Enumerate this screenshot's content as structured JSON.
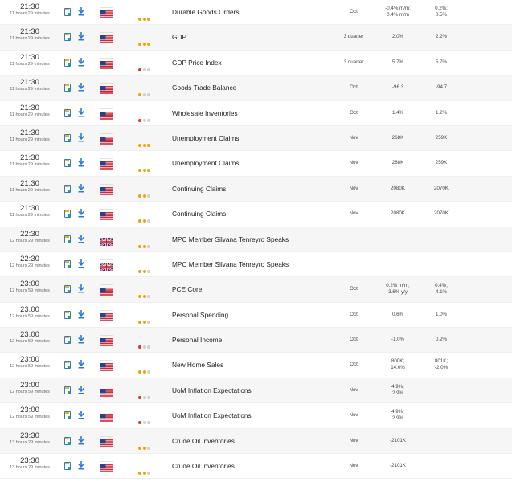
{
  "rows": [
    {
      "time": "21:30",
      "remaining": "11 hours 29 minutes",
      "country": "US",
      "importance": [
        "orange",
        "orange",
        "orange"
      ],
      "name": "Durable Goods Orders",
      "period": "Oct",
      "actual": "-0.4% m/m;\n0.4% m/m",
      "previous": "0.2%;\n0.5%"
    },
    {
      "time": "21:30",
      "remaining": "11 hours 29 minutes",
      "country": "US",
      "importance": [
        "orange",
        "orange",
        "orange"
      ],
      "name": "GDP",
      "period": "3 quarter",
      "actual": "2.0%",
      "previous": "2.2%"
    },
    {
      "time": "21:30",
      "remaining": "11 hours 29 minutes",
      "country": "US",
      "importance": [
        "red",
        "grey",
        "grey"
      ],
      "name": "GDP Price Index",
      "period": "3 quarter",
      "actual": "5.7%",
      "previous": "5.7%"
    },
    {
      "time": "21:30",
      "remaining": "11 hours 29 minutes",
      "country": "US",
      "importance": [
        "orange",
        "grey",
        "grey"
      ],
      "name": "Goods Trade Balance",
      "period": "Oct",
      "actual": "-96.3",
      "previous": "-94.7"
    },
    {
      "time": "21:30",
      "remaining": "11 hours 29 minutes",
      "country": "US",
      "importance": [
        "red",
        "grey",
        "grey"
      ],
      "name": "Wholesale Inventories",
      "period": "Oct",
      "actual": "1.4%",
      "previous": "1.2%"
    },
    {
      "time": "21:30",
      "remaining": "11 hours 29 minutes",
      "country": "US",
      "importance": [
        "orange",
        "orange",
        "orange"
      ],
      "name": "Unemployment Claims",
      "period": "Nov",
      "actual": "268K",
      "previous": "259K"
    },
    {
      "time": "21:30",
      "remaining": "11 hours 29 minutes",
      "country": "US",
      "importance": [
        "orange",
        "orange",
        "orange"
      ],
      "name": "Unemployment Claims",
      "period": "Nov",
      "actual": "268K",
      "previous": "259K"
    },
    {
      "time": "21:30",
      "remaining": "11 hours 29 minutes",
      "country": "US",
      "importance": [
        "orange",
        "orange",
        "grey"
      ],
      "name": "Continuing Claims",
      "period": "Nov",
      "actual": "2080K",
      "previous": "2070K"
    },
    {
      "time": "21:30",
      "remaining": "11 hours 29 minutes",
      "country": "US",
      "importance": [
        "orange",
        "orange",
        "grey"
      ],
      "name": "Continuing Claims",
      "period": "Nov",
      "actual": "2080K",
      "previous": "2070K"
    },
    {
      "time": "22:30",
      "remaining": "12 hours 29 minutes",
      "country": "UK",
      "importance": [
        "orange",
        "orange",
        "grey"
      ],
      "name": "MPC Member Silvana Tenreyro Speaks",
      "period": "",
      "actual": "",
      "previous": ""
    },
    {
      "time": "22:30",
      "remaining": "12 hours 29 minutes",
      "country": "UK",
      "importance": [
        "orange",
        "orange",
        "grey"
      ],
      "name": "MPC Member Silvana Tenreyro Speaks",
      "period": "",
      "actual": "",
      "previous": ""
    },
    {
      "time": "23:00",
      "remaining": "12 hours 59 minutes",
      "country": "US",
      "importance": [
        "orange",
        "orange",
        "grey"
      ],
      "name": "PCE Core",
      "period": "Oct",
      "actual": "0.2% m/m;\n3.6% y/y",
      "previous": "0.4%;\n4.1%"
    },
    {
      "time": "23:00",
      "remaining": "12 hours 59 minutes",
      "country": "US",
      "importance": [
        "orange",
        "orange",
        "grey"
      ],
      "name": "Personal Spending",
      "period": "Oct",
      "actual": "0.6%",
      "previous": "1.0%"
    },
    {
      "time": "23:00",
      "remaining": "12 hours 59 minutes",
      "country": "US",
      "importance": [
        "red",
        "grey",
        "grey"
      ],
      "name": "Personal Income",
      "period": "Oct",
      "actual": "-1.0%",
      "previous": "0.2%"
    },
    {
      "time": "23:00",
      "remaining": "12 hours 59 minutes",
      "country": "US",
      "importance": [
        "orange",
        "orange",
        "grey"
      ],
      "name": "New Home Sales",
      "period": "Oct",
      "actual": "800K;\n14.0%",
      "previous": "801K;\n-2.0%"
    },
    {
      "time": "23:00",
      "remaining": "12 hours 59 minutes",
      "country": "US",
      "importance": [
        "red",
        "grey",
        "grey"
      ],
      "name": "UoM Inflation Expectations",
      "period": "Nov",
      "actual": "4.9%;\n2.9%",
      "previous": ""
    },
    {
      "time": "23:00",
      "remaining": "12 hours 59 minutes",
      "country": "US",
      "importance": [
        "red",
        "grey",
        "grey"
      ],
      "name": "UoM Inflation Expectations",
      "period": "Nov",
      "actual": "4.9%;\n2.9%",
      "previous": ""
    },
    {
      "time": "23:30",
      "remaining": "13 hours 29 minutes",
      "country": "US",
      "importance": [
        "orange",
        "orange",
        "grey"
      ],
      "name": "Crude Oil Inventories",
      "period": "Nov",
      "actual": "-2101K",
      "previous": ""
    },
    {
      "time": "23:30",
      "remaining": "13 hours 29 minutes",
      "country": "US",
      "importance": [
        "orange",
        "orange",
        "grey"
      ],
      "name": "Crude Oil Inventories",
      "period": "Nov",
      "actual": "-2101K",
      "previous": ""
    }
  ],
  "colors": {
    "importance_orange": "#f0a30a",
    "importance_red": "#e0342f",
    "importance_grey": "#d0d0d0",
    "icon_blue": "#2d7ad6"
  },
  "icons": {
    "calendar": "add-to-calendar-icon",
    "download": "download-icon",
    "flag_us": "us-flag-icon",
    "flag_uk": "uk-flag-icon"
  }
}
